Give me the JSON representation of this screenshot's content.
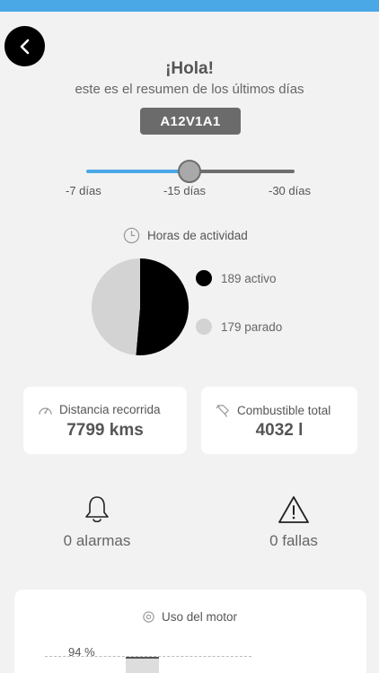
{
  "header": {
    "back_label": "Back",
    "greeting": "¡Hola!",
    "subtitle": "este es el resumen de los últimos días",
    "plate": "A12V1A1"
  },
  "range_slider": {
    "labels": [
      "-7 días",
      "-15 días",
      "-30 días"
    ],
    "selected": "-15 días"
  },
  "activity": {
    "title": "Horas de actividad",
    "chart_data": {
      "type": "pie",
      "categories": [
        "activo",
        "parado"
      ],
      "values": [
        189,
        179
      ]
    },
    "legend": [
      {
        "label": "189 activo",
        "color": "#000000"
      },
      {
        "label": "179 parado",
        "color": "#d3d3d3"
      }
    ]
  },
  "cards": {
    "distance": {
      "title": "Distancia recorrida",
      "value": "7799 kms",
      "icon": "speedometer-icon"
    },
    "fuel": {
      "title": "Combustible total",
      "value": "4032 l",
      "icon": "fuel-nozzle-icon"
    }
  },
  "stats": {
    "alarms": {
      "label": "0 alarmas",
      "icon": "bell-icon"
    },
    "faults": {
      "label": "0 fallas",
      "icon": "warning-icon"
    }
  },
  "motor": {
    "title": "Uso del motor",
    "percent_label": "94 %",
    "icon": "gear-icon"
  },
  "colors": {
    "accent": "#4aa8e6",
    "background": "#f2f2f2",
    "plate": "#6b6b6b"
  }
}
